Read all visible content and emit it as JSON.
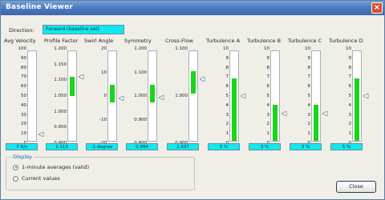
{
  "window": {
    "title": "Baseline Viewer",
    "close_glyph": "×"
  },
  "direction": {
    "label": "Direction:",
    "value": "Forward (baseline set)"
  },
  "colors": {
    "fill": "#19d619",
    "readout_bg": "#11e8f0"
  },
  "gauges": [
    {
      "title": "Avg Velocity",
      "ticks": [
        "100",
        "90",
        "80",
        "70",
        "60",
        "50",
        "40",
        "30",
        "20",
        "10",
        "0"
      ],
      "range": [
        0,
        100
      ],
      "fill": [
        0,
        0
      ],
      "pointer": 7,
      "readout": "7 ft/s"
    },
    {
      "title": "Profile Factor",
      "ticks": [
        "1.200",
        "1.150",
        "1.100",
        "1.050",
        "1.000",
        "0.950",
        "0.900"
      ],
      "range": [
        0.9,
        1.2
      ],
      "fill": [
        1.05,
        1.115
      ],
      "pointer": 1.113,
      "readout": "1.113"
    },
    {
      "title": "Swirl Angle",
      "ticks": [
        "20",
        "10",
        "0",
        "-10",
        "-20"
      ],
      "range": [
        -20,
        20
      ],
      "fill": [
        -3,
        5
      ],
      "pointer": -1,
      "readout": "-1 degree"
    },
    {
      "title": "Symmetry",
      "ticks": [
        "1.200",
        "1.100",
        "1.000",
        "0.900",
        "0.800"
      ],
      "range": [
        0.8,
        1.2
      ],
      "fill": [
        0.97,
        1.05
      ],
      "pointer": 0.994,
      "readout": "0.994"
    },
    {
      "title": "Cross-Flow",
      "ticks": [
        "1.100",
        "1.000",
        "0.900"
      ],
      "range": [
        0.9,
        1.1
      ],
      "fill": [
        1.005,
        1.055
      ],
      "pointer": 1.037,
      "readout": "1.037"
    },
    {
      "title": "Turbulence A",
      "ticks": [
        "10",
        "9",
        "8",
        "7",
        "6",
        "5",
        "4",
        "3",
        "2",
        "1",
        "0"
      ],
      "range": [
        0,
        10
      ],
      "fill": [
        0,
        7
      ],
      "pointer": 5,
      "readout": "5 %"
    },
    {
      "title": "Turbulence B",
      "ticks": [
        "10",
        "9",
        "8",
        "7",
        "6",
        "5",
        "4",
        "3",
        "2",
        "1",
        "0"
      ],
      "range": [
        0,
        10
      ],
      "fill": [
        0,
        4
      ],
      "pointer": 3,
      "readout": "3 %"
    },
    {
      "title": "Turbulence C",
      "ticks": [
        "10",
        "9",
        "8",
        "7",
        "6",
        "5",
        "4",
        "3",
        "2",
        "1",
        "0"
      ],
      "range": [
        0,
        10
      ],
      "fill": [
        0,
        4
      ],
      "pointer": 3,
      "readout": "3 %"
    },
    {
      "title": "Turbulence D",
      "ticks": [
        "10",
        "9",
        "8",
        "7",
        "6",
        "5",
        "4",
        "3",
        "2",
        "1",
        "0"
      ],
      "range": [
        0,
        10
      ],
      "fill": [
        0,
        7
      ],
      "pointer": 5,
      "readout": "5 %"
    }
  ],
  "display": {
    "legend": "Display",
    "options": [
      {
        "label": "1-minute averages (valid)",
        "checked": true
      },
      {
        "label": "Current values",
        "checked": false
      }
    ]
  },
  "close_button": {
    "label": "Close"
  }
}
